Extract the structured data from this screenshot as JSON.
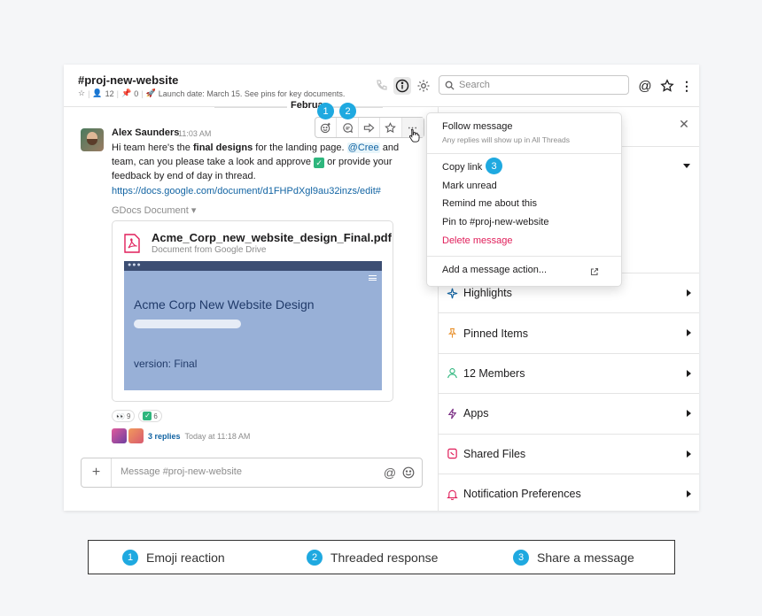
{
  "header": {
    "channel_name": "#proj-new-website",
    "members_count": "12",
    "pins_count": "0",
    "topic": "Launch date: March 15. See pins for key documents.",
    "search_placeholder": "Search"
  },
  "date_divider": "February 26th, 2019",
  "date_divider_visible": "Februa",
  "message": {
    "author": "Alex Saunders",
    "time": "11:03 AM",
    "text_before": "Hi team here's the ",
    "text_bold": "final designs",
    "text_mid": " for the landing page. ",
    "mention": "@Cree",
    "text_after": " and team, can you please take a look and approve ",
    "text_end": " or provide your feedback by end of day in thread.",
    "check_glyph": "✓",
    "link": "https://docs.google.com/document/d1FHPdXgl9au32inzs/edit#",
    "gdocs_label": "GDocs Document ▾"
  },
  "attachment": {
    "file_name": "Acme_Corp_new_website_design_Final.pdf",
    "file_sub": "Document from Google Drive",
    "preview_dots": "●●●",
    "preview_title": "Acme Corp New Website Design",
    "preview_version": "version: Final"
  },
  "reactions": [
    {
      "emoji": "👀",
      "count": "9"
    },
    {
      "emoji": "✓",
      "count": "6"
    }
  ],
  "thread": {
    "replies": "3 replies",
    "time": "Today at 11:18 AM"
  },
  "composer": {
    "placeholder": "Message #proj-new-website",
    "plus": "+"
  },
  "menu": {
    "follow": "Follow message",
    "follow_sub": "Any replies will show up in All Threads",
    "copy_link": "Copy link",
    "mark_unread": "Mark unread",
    "remind": "Remind me about this",
    "pin": "Pin to #proj-new-website",
    "delete": "Delete message",
    "add_action": "Add a message action..."
  },
  "sidepane": {
    "close": "✕",
    "items": [
      {
        "label": "Highlights",
        "icon": "sparkle-icon",
        "color": "#1264a3"
      },
      {
        "label": "Pinned Items",
        "icon": "pin-icon",
        "color": "#e8912d"
      },
      {
        "label": "12 Members",
        "icon": "person-icon",
        "color": "#2eb67d"
      },
      {
        "label": "Apps",
        "icon": "bolt-icon",
        "color": "#7c3085"
      },
      {
        "label": "Shared Files",
        "icon": "file-icon",
        "color": "#e01e5a"
      },
      {
        "label": "Notification Preferences",
        "icon": "bell-icon",
        "color": "#e01e5a"
      }
    ]
  },
  "badges": {
    "one": "1",
    "two": "2",
    "three": "3"
  },
  "legend": [
    {
      "num": "1",
      "label": "Emoji reaction"
    },
    {
      "num": "2",
      "label": "Threaded response"
    },
    {
      "num": "3",
      "label": "Share a message"
    }
  ],
  "colors": {
    "badge": "#1fa9e0",
    "link": "#1264a3",
    "danger": "#e01e5a",
    "success": "#2eb67d"
  }
}
